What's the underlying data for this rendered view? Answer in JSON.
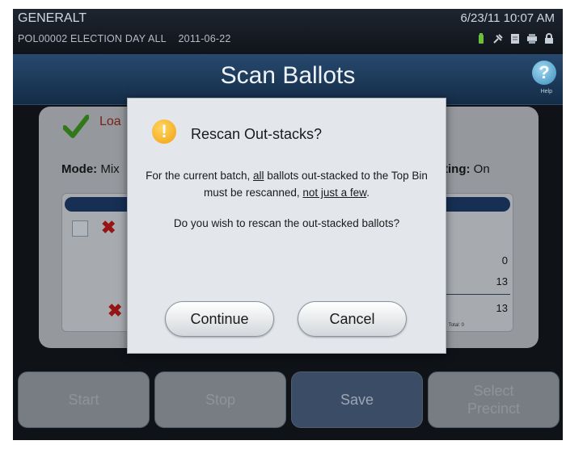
{
  "status": {
    "name": "GENERALT",
    "election": "POL00002 ELECTION DAY ALL",
    "election_date": "2011-06-22",
    "date_time": "6/23/11   10:07 AM",
    "icons": [
      "battery-icon",
      "plug-icon",
      "document-icon",
      "printer-icon",
      "lock-icon"
    ]
  },
  "header": {
    "title": "Scan Ballots",
    "help_label": "Help"
  },
  "background_panel": {
    "loaded_text": "Loa",
    "mode_label": "Mode:",
    "mode_value": "Mix",
    "sorting_label": "orting:",
    "sorting_value": "On",
    "counts": [
      "0",
      "13",
      "13"
    ],
    "total_text": "Total: 0"
  },
  "buttons": {
    "start": "Start",
    "stop": "Stop",
    "save": "Save",
    "select_precinct_1": "Select",
    "select_precinct_2": "Precinct"
  },
  "dialog": {
    "title": "Rescan Out-stacks?",
    "body1_a": "For the current batch, ",
    "body1_u1": "all",
    "body1_b": " ballots out-stacked to the Top Bin must be rescanned, ",
    "body1_u2": "not just a few",
    "body1_c": ".",
    "body2": "Do you wish to rescan the out-stacked ballots?",
    "continue_label": "Continue",
    "cancel_label": "Cancel"
  },
  "colors": {
    "screen_bg": "#14181e",
    "title_bar": "#27496e",
    "dialog_bg": "#e3e7ec",
    "warning_icon": "#f0a010",
    "error_x": "#c21a1a"
  }
}
